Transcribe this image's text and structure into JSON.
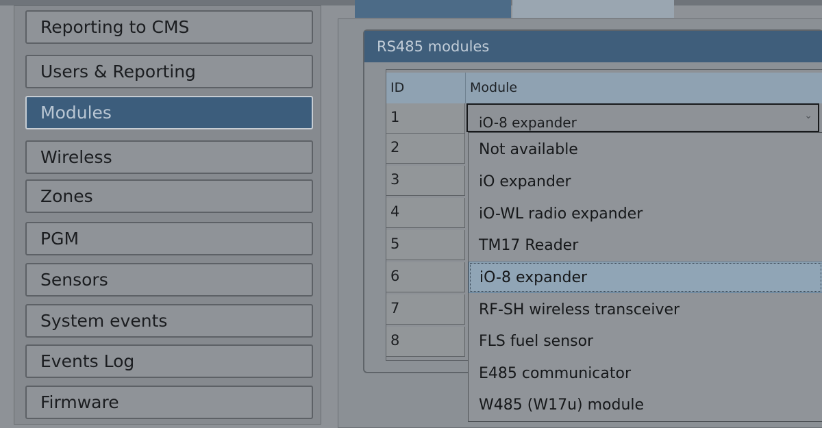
{
  "sidebar": {
    "items": [
      {
        "label": "Reporting to CMS"
      },
      {
        "label": "Users & Reporting"
      },
      {
        "label": "Modules"
      },
      {
        "label": "Wireless"
      },
      {
        "label": "Zones"
      },
      {
        "label": "PGM"
      },
      {
        "label": "Sensors"
      },
      {
        "label": "System events"
      },
      {
        "label": "Events Log"
      },
      {
        "label": "Firmware"
      }
    ],
    "selected": "Modules"
  },
  "panel": {
    "title": "RS485 modules",
    "columns": {
      "id": "ID",
      "module": "Module"
    },
    "rows": [
      {
        "id": "1",
        "module": "iO-8 expander"
      },
      {
        "id": "2"
      },
      {
        "id": "3"
      },
      {
        "id": "4"
      },
      {
        "id": "5"
      },
      {
        "id": "6"
      },
      {
        "id": "7"
      },
      {
        "id": "8"
      }
    ],
    "combo": {
      "value": "iO-8 expander",
      "arrow": "⌄",
      "options": [
        "Not available",
        "iO expander",
        "iO-WL radio expander",
        "TM17 Reader",
        "iO-8 expander",
        "RF-SH wireless transceiver",
        "FLS fuel sensor",
        "E485 communicator",
        "W485 (W17u) module"
      ],
      "highlighted": "iO-8 expander"
    }
  },
  "colors": {
    "accent": "#3c5d7c",
    "header": "#8fa2b2",
    "highlight": "#90a5b6"
  }
}
